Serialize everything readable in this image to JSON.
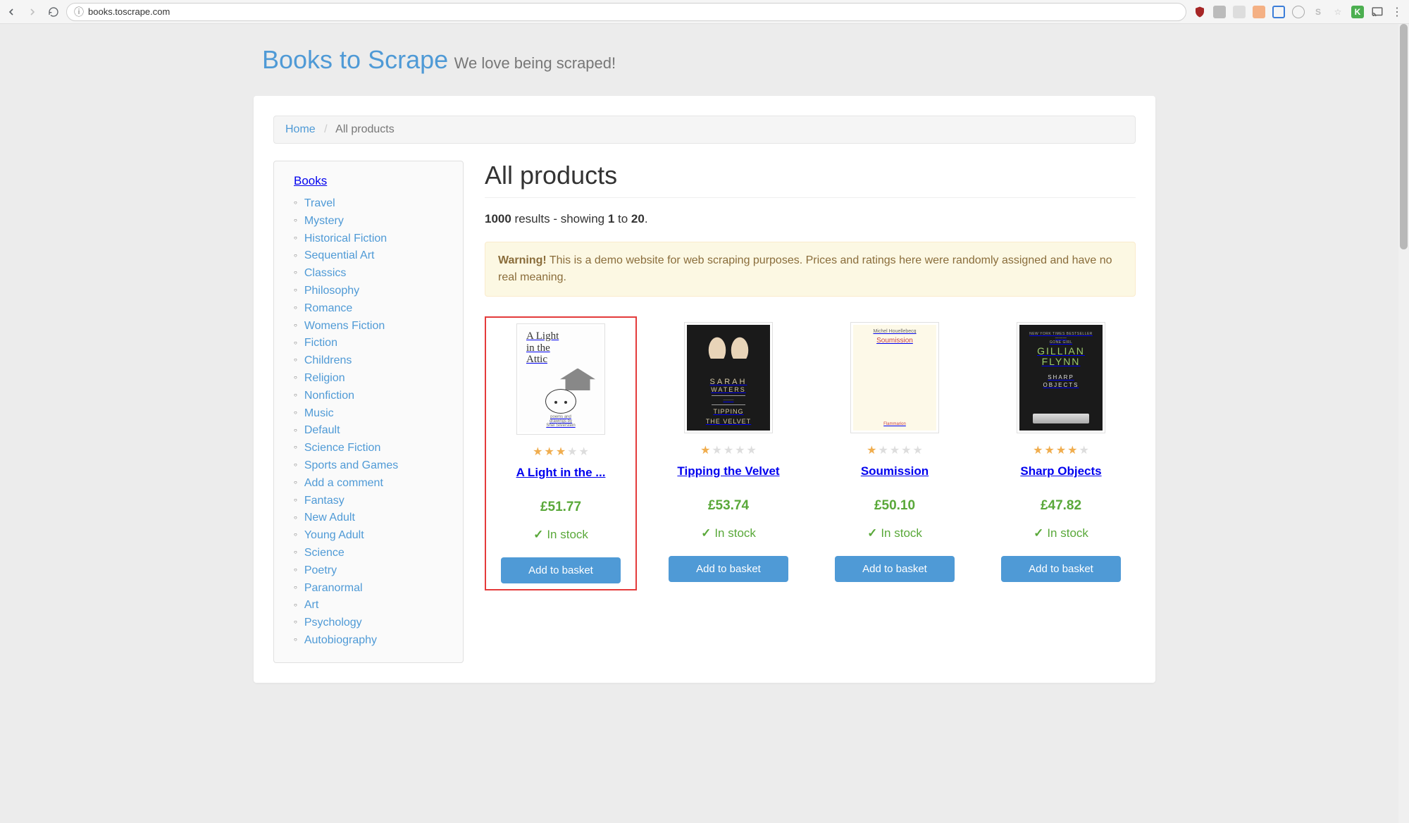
{
  "browser": {
    "url": "books.toscrape.com"
  },
  "site": {
    "title": "Books to Scrape",
    "tagline": "We love being scraped!"
  },
  "breadcrumb": {
    "home": "Home",
    "current": "All products"
  },
  "sidebar": {
    "heading": "Books",
    "categories": [
      "Travel",
      "Mystery",
      "Historical Fiction",
      "Sequential Art",
      "Classics",
      "Philosophy",
      "Romance",
      "Womens Fiction",
      "Fiction",
      "Childrens",
      "Religion",
      "Nonfiction",
      "Music",
      "Default",
      "Science Fiction",
      "Sports and Games",
      "Add a comment",
      "Fantasy",
      "New Adult",
      "Young Adult",
      "Science",
      "Poetry",
      "Paranormal",
      "Art",
      "Psychology",
      "Autobiography"
    ]
  },
  "page_title": "All products",
  "results": {
    "total": "1000",
    "text_mid": " results - showing ",
    "from": "1",
    "text_to": " to ",
    "to": "20",
    "text_end": "."
  },
  "alert": {
    "strong": "Warning!",
    "text": " This is a demo website for web scraping purposes. Prices and ratings here were randomly assigned and have no real meaning."
  },
  "products": [
    {
      "title": "A Light in the ...",
      "price": "£51.77",
      "stock": "In stock",
      "rating": 3,
      "button": "Add to basket",
      "highlighted": true
    },
    {
      "title": "Tipping the Velvet",
      "price": "£53.74",
      "stock": "In stock",
      "rating": 1,
      "button": "Add to basket",
      "highlighted": false
    },
    {
      "title": "Soumission",
      "price": "£50.10",
      "stock": "In stock",
      "rating": 1,
      "button": "Add to basket",
      "highlighted": false
    },
    {
      "title": "Sharp Objects",
      "price": "£47.82",
      "stock": "In stock",
      "rating": 4,
      "button": "Add to basket",
      "highlighted": false
    }
  ]
}
